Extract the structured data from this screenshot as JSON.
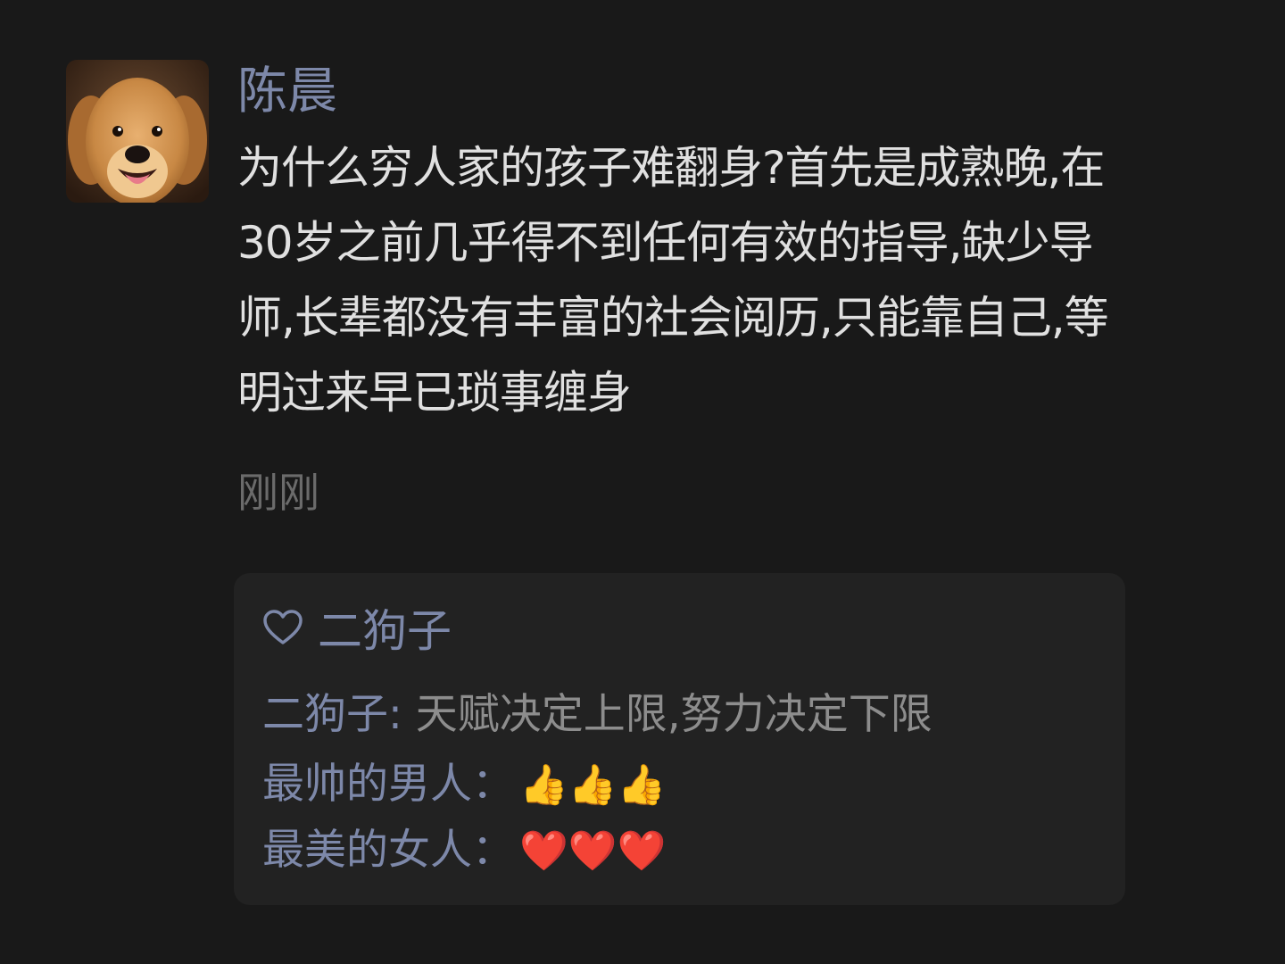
{
  "post": {
    "author": "陈晨",
    "avatar": "golden-retriever-photo",
    "text": "为什么穷人家的孩子难翻身?首先是成熟晚,在30岁之前几乎得不到任何有效的指导,缺少导师,长辈都没有丰富的社会阅历,只能靠自己,等明过来早已琐事缠身",
    "timestamp": "刚刚"
  },
  "likes": {
    "icon": "heart-outline-icon",
    "names": "二狗子"
  },
  "comments": [
    {
      "author": "二狗子",
      "separator": ": ",
      "text": "天赋决定上限,努力决定下限"
    },
    {
      "author": "最帅的男人",
      "separator": "：",
      "text": "👍👍👍"
    },
    {
      "author": "最美的女人",
      "separator": "：",
      "text": "❤️❤️❤️"
    }
  ],
  "colors": {
    "background": "#191919",
    "name_accent": "#7d88a9",
    "panel": "#222222",
    "text": "#e0e0e0"
  }
}
